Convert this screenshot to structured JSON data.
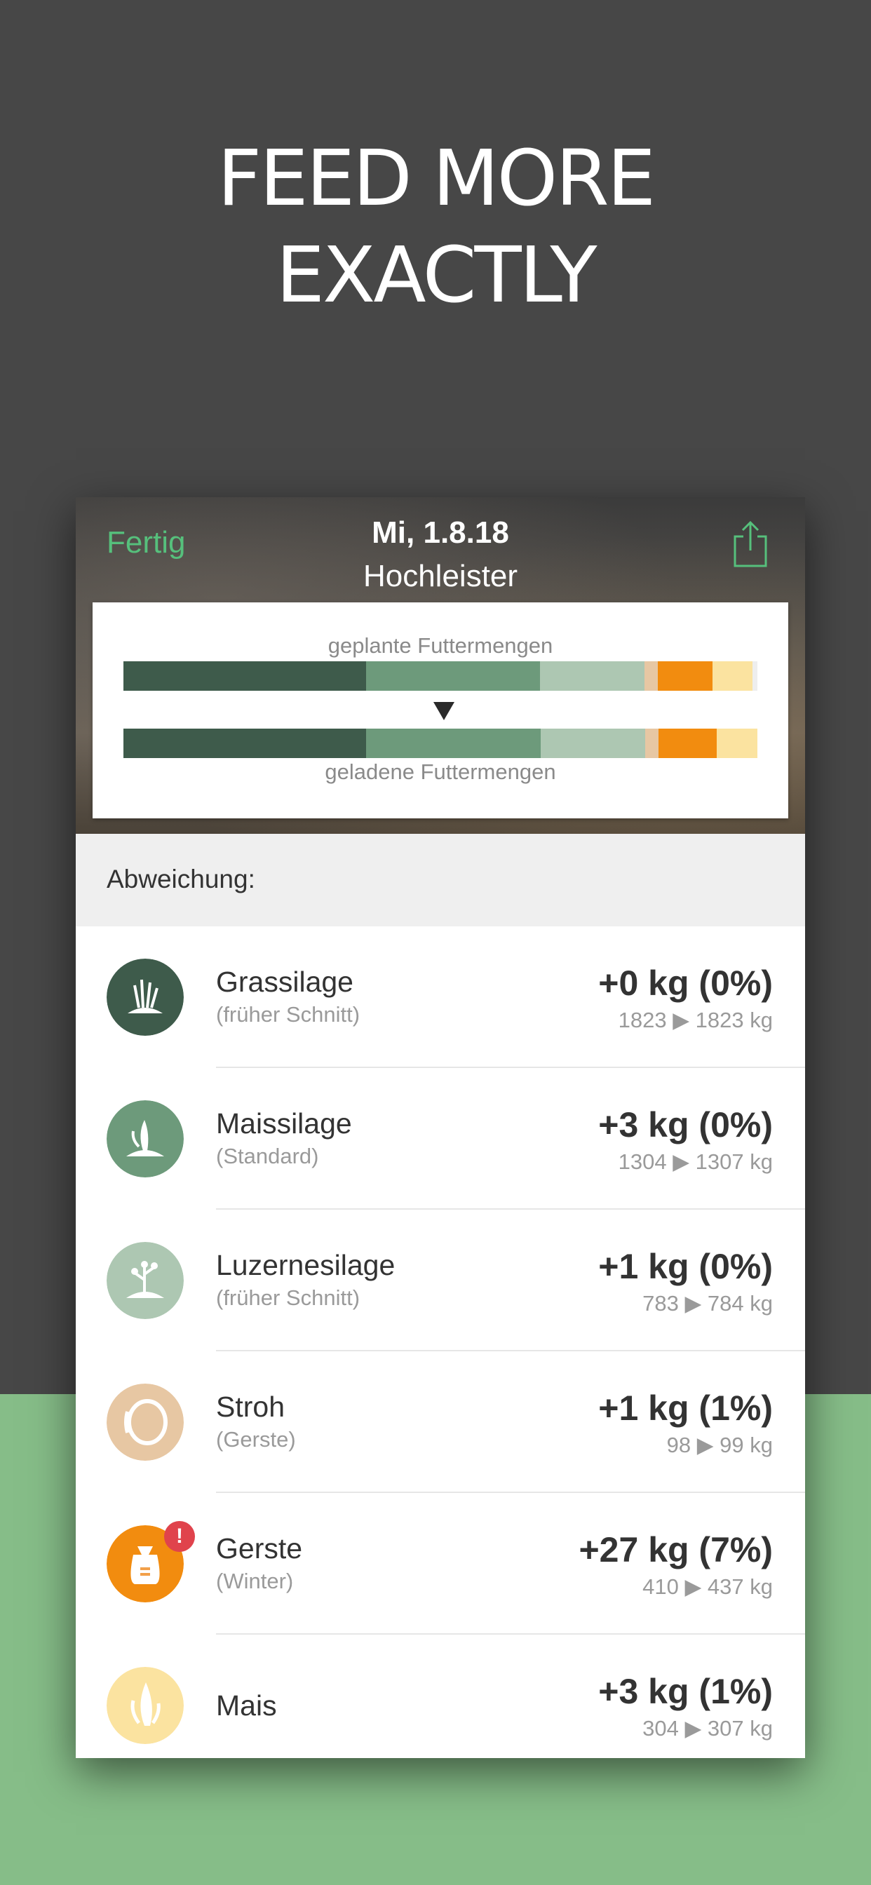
{
  "headline": {
    "line1": "FEED MORE",
    "line2": "EXACTLY"
  },
  "nav": {
    "done_label": "Fertig",
    "date": "Mi, 1.8.18",
    "group": "Hochleister",
    "share_icon": "share-icon"
  },
  "chart_data": {
    "type": "bar",
    "planned_label": "geplante Futtermengen",
    "loaded_label": "geladene Futtermengen",
    "categories": [
      "Grassilage",
      "Maissilage",
      "Luzernesilage",
      "Stroh",
      "Gerste",
      "Mais"
    ],
    "series": [
      {
        "name": "geplante Futtermengen",
        "values": [
          1823,
          1304,
          783,
          98,
          410,
          304
        ]
      },
      {
        "name": "geladene Futtermengen",
        "values": [
          1823,
          1307,
          784,
          99,
          437,
          307
        ]
      }
    ]
  },
  "section_title": "Abweichung:",
  "items": [
    {
      "name": "Grassilage",
      "sub": "(früher Schnitt)",
      "delta": "+0 kg (0%)",
      "range": "1823 ▶ 1823 kg",
      "color": "#3e5b4b",
      "icon": "grass-icon"
    },
    {
      "name": "Maissilage",
      "sub": "(Standard)",
      "delta": "+3 kg (0%)",
      "range": "1304 ▶ 1307 kg",
      "color": "#6d9a7b",
      "icon": "corn-silage-icon"
    },
    {
      "name": "Luzernesilage",
      "sub": "(früher Schnitt)",
      "delta": "+1 kg (0%)",
      "range": "783 ▶ 784 kg",
      "color": "#adc7b2",
      "icon": "alfalfa-icon"
    },
    {
      "name": "Stroh",
      "sub": "(Gerste)",
      "delta": "+1 kg (1%)",
      "range": "98 ▶ 99 kg",
      "color": "#e7c7a3",
      "icon": "straw-bale-icon"
    },
    {
      "name": "Gerste",
      "sub": "(Winter)",
      "delta": "+27 kg (7%)",
      "range": "410 ▶ 437 kg",
      "color": "#f28c0f",
      "icon": "grain-sack-icon",
      "badge": "!"
    },
    {
      "name": "Mais",
      "sub": "",
      "delta": "+3 kg (1%)",
      "range": "304 ▶ 307 kg",
      "color": "#fbe3a0",
      "icon": "corn-icon"
    }
  ],
  "colors": {
    "accent": "#56c07c",
    "background_top": "#474747",
    "background_bottom": "#86bd88"
  }
}
